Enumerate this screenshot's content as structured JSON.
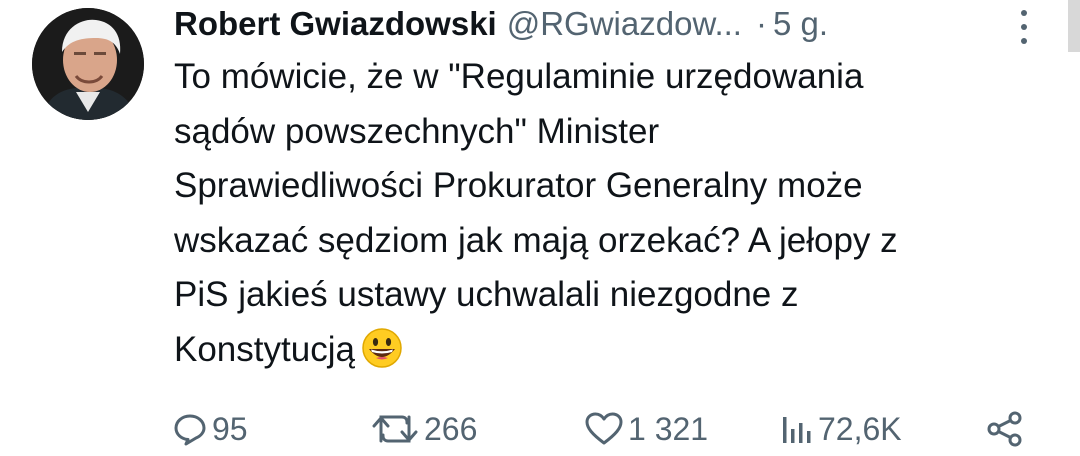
{
  "author": {
    "name": "Robert Gwiazdowski",
    "handle": "@RGwiazdow...",
    "separator": "·",
    "time": "5 g."
  },
  "tweet": {
    "lines": [
      "To mówicie, że w \"Regulaminie urzędowania",
      "sądów powszechnych\" Minister",
      "Sprawiedliwości Prokurator Generalny może",
      "wskazać sędziom jak mają orzekać? A jełopy z",
      "PiS jakieś ustawy uchwalali niezgodne z",
      "Konstytucją"
    ],
    "emoji": "grinning-face"
  },
  "actions": {
    "replies": "95",
    "reposts": "266",
    "likes": "1 321",
    "views": "72,6K"
  },
  "icons": [
    "more-vertical-icon",
    "reply-icon",
    "repost-icon",
    "like-icon",
    "views-icon",
    "share-icon"
  ],
  "colors": {
    "text": "#0f1419",
    "secondary": "#536471",
    "emoji_yellow": "#ffcc22"
  }
}
